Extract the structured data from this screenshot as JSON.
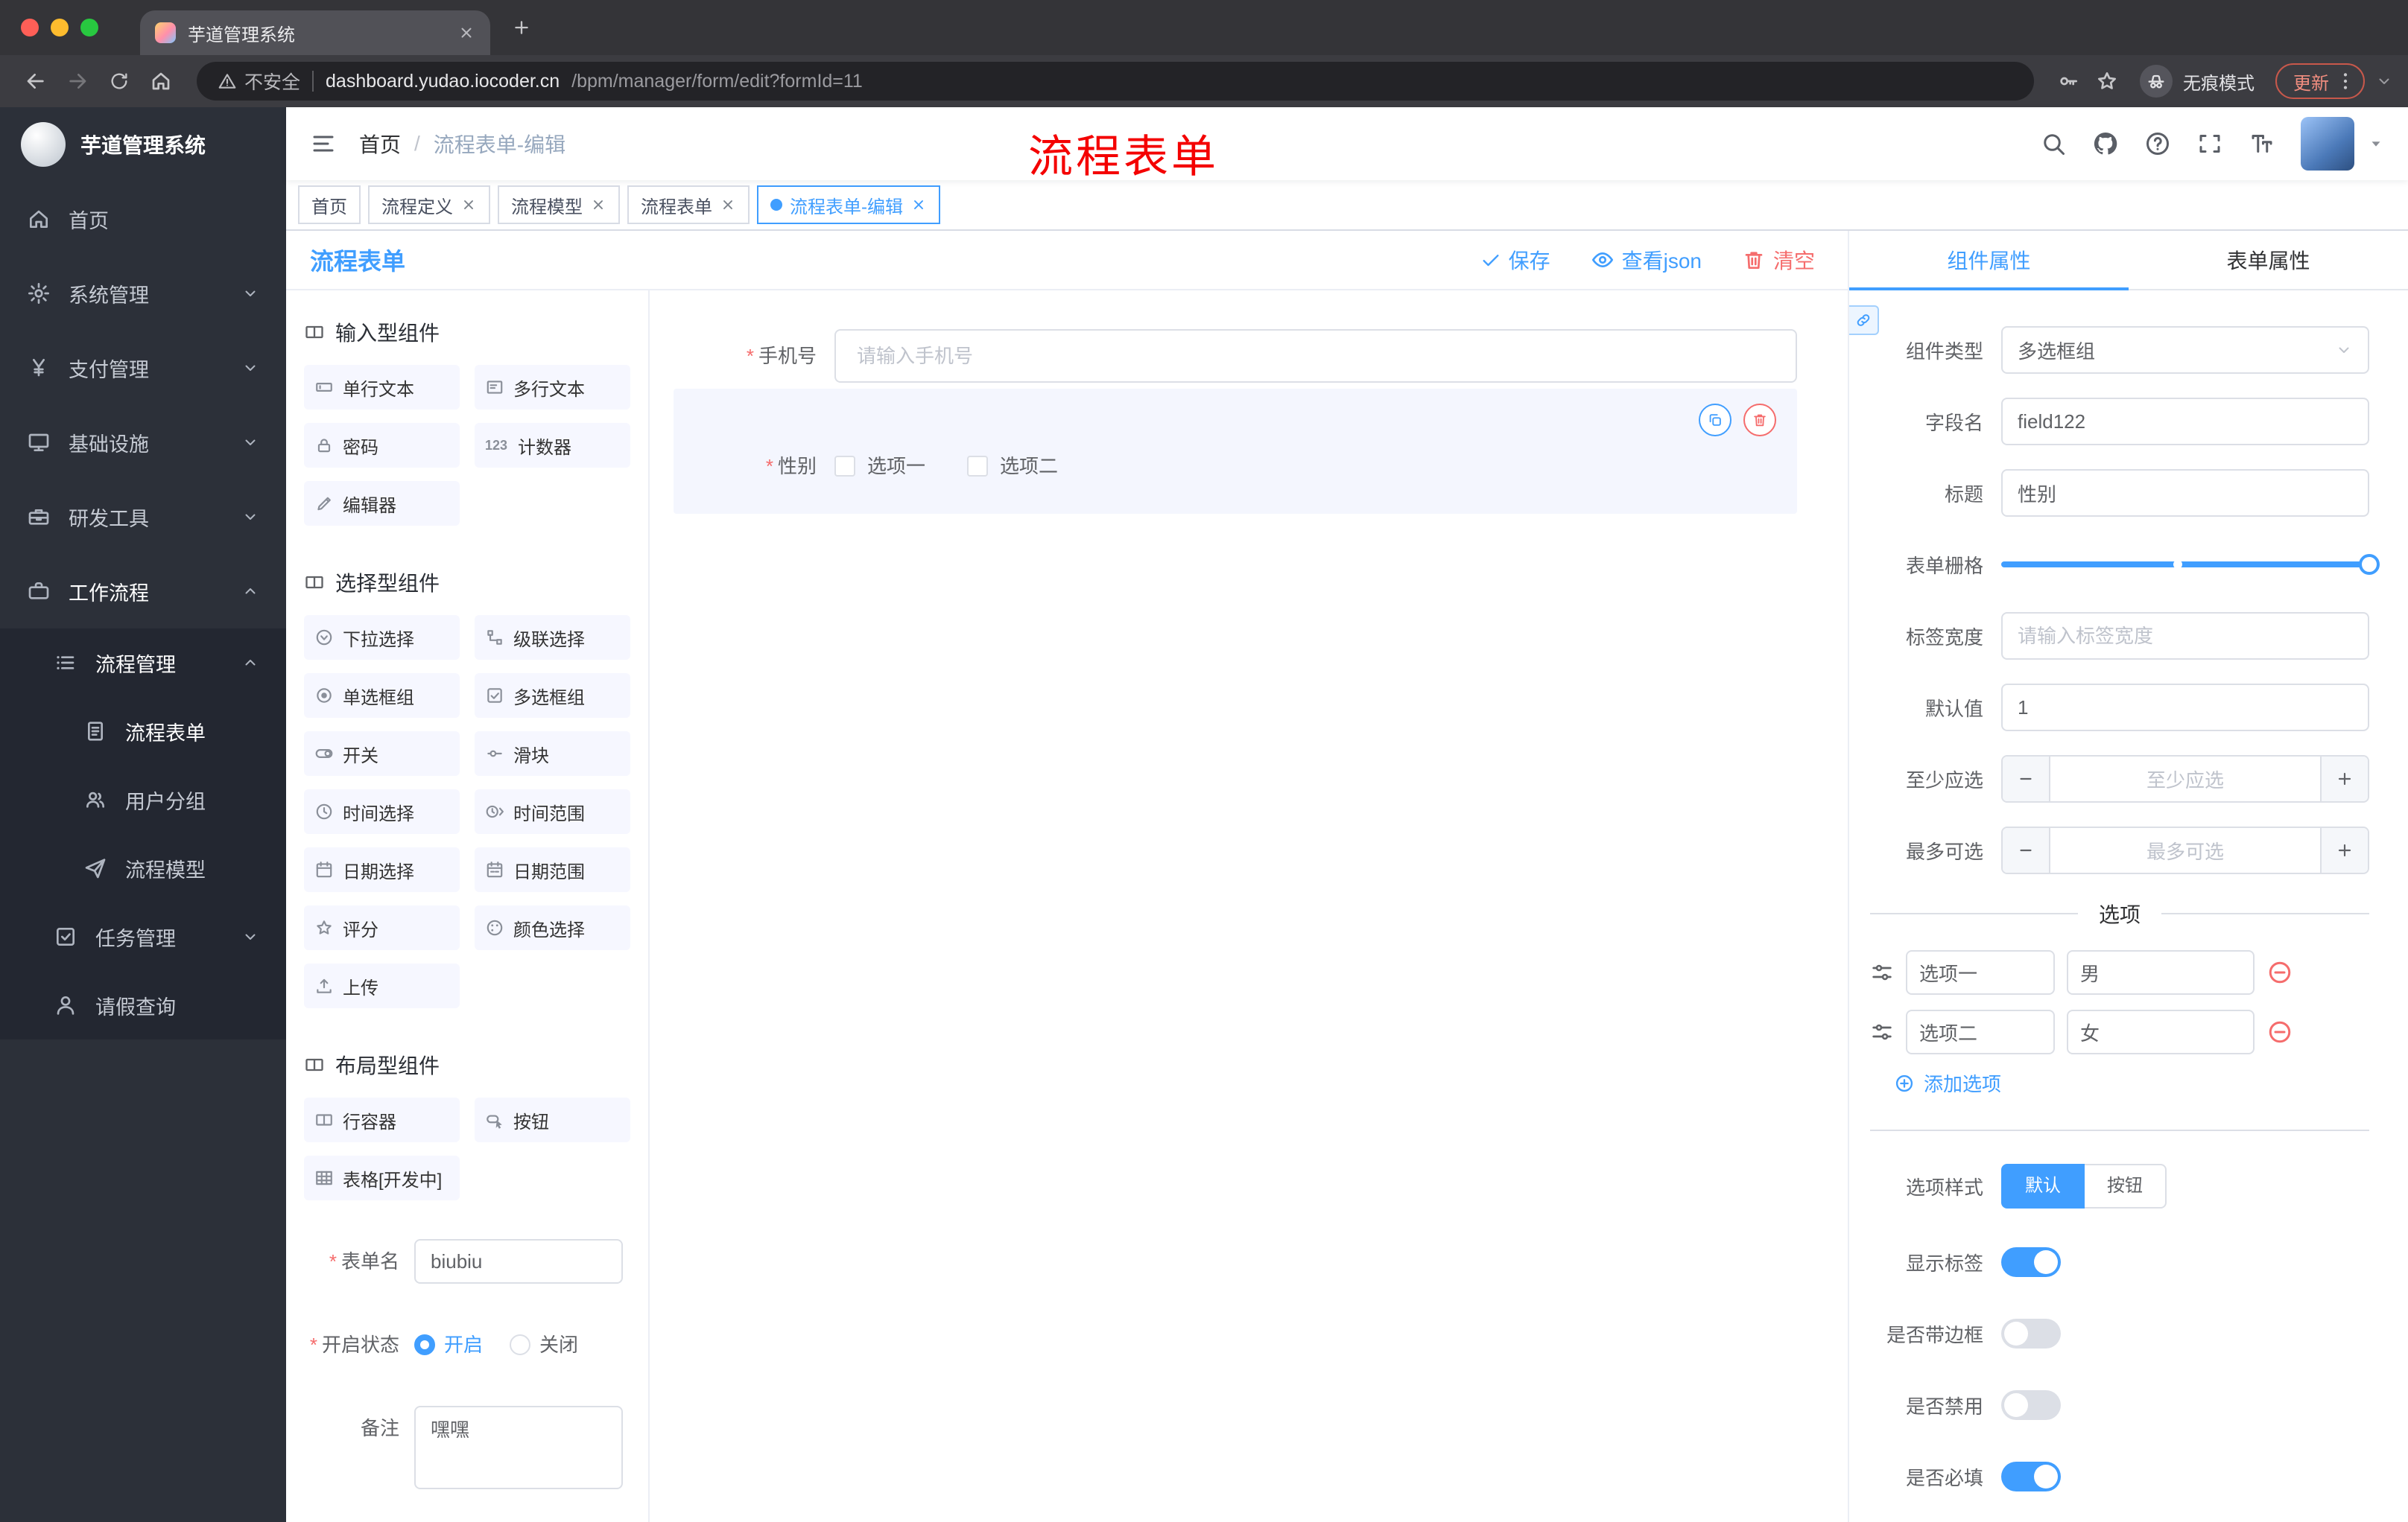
{
  "browser": {
    "tab_title": "芋道管理系统",
    "security_label": "不安全",
    "url_host": "dashboard.yudao.iocoder.cn",
    "url_path": "/bpm/manager/form/edit?formId=11",
    "incognito_label": "无痕模式",
    "update_label": "更新"
  },
  "sidebar": {
    "logo_title": "芋道管理系统",
    "items": [
      {
        "label": "首页",
        "icon": "home-icon"
      },
      {
        "label": "系统管理",
        "icon": "gear-icon"
      },
      {
        "label": "支付管理",
        "icon": "yen-icon"
      },
      {
        "label": "基础设施",
        "icon": "monitor-icon"
      },
      {
        "label": "研发工具",
        "icon": "toolbox-icon"
      },
      {
        "label": "工作流程",
        "icon": "briefcase-icon"
      },
      {
        "label": "流程管理",
        "icon": "list-icon"
      },
      {
        "label": "流程表单",
        "icon": "document-icon"
      },
      {
        "label": "用户分组",
        "icon": "users-icon"
      },
      {
        "label": "流程模型",
        "icon": "send-icon"
      },
      {
        "label": "任务管理",
        "icon": "tasks-icon"
      },
      {
        "label": "请假查询",
        "icon": "person-icon"
      }
    ]
  },
  "header": {
    "breadcrumb_home": "首页",
    "breadcrumb_sep": "/",
    "breadcrumb_current": "流程表单-编辑",
    "annotation": "流程表单"
  },
  "tags": [
    {
      "label": "首页",
      "closable": false,
      "active": false
    },
    {
      "label": "流程定义",
      "closable": true,
      "active": false
    },
    {
      "label": "流程模型",
      "closable": true,
      "active": false
    },
    {
      "label": "流程表单",
      "closable": true,
      "active": false
    },
    {
      "label": "流程表单-编辑",
      "closable": true,
      "active": true
    }
  ],
  "designer": {
    "title": "流程表单",
    "save_label": "保存",
    "view_json_label": "查看json",
    "clear_label": "清空",
    "component_groups": [
      {
        "title": "输入型组件",
        "items": [
          {
            "label": "单行文本",
            "icon": "input-icon"
          },
          {
            "label": "多行文本",
            "icon": "textarea-icon"
          },
          {
            "label": "密码",
            "icon": "lock-icon"
          },
          {
            "label": "计数器",
            "icon": "counter-icon"
          },
          {
            "label": "编辑器",
            "icon": "editor-icon"
          }
        ]
      },
      {
        "title": "选择型组件",
        "items": [
          {
            "label": "下拉选择",
            "icon": "select-icon"
          },
          {
            "label": "级联选择",
            "icon": "cascade-icon"
          },
          {
            "label": "单选框组",
            "icon": "radio-icon"
          },
          {
            "label": "多选框组",
            "icon": "checkbox-icon"
          },
          {
            "label": "开关",
            "icon": "switch-icon"
          },
          {
            "label": "滑块",
            "icon": "slider-icon"
          },
          {
            "label": "时间选择",
            "icon": "clock-icon"
          },
          {
            "label": "时间范围",
            "icon": "time-range-icon"
          },
          {
            "label": "日期选择",
            "icon": "calendar-icon"
          },
          {
            "label": "日期范围",
            "icon": "date-range-icon"
          },
          {
            "label": "评分",
            "icon": "star-icon"
          },
          {
            "label": "颜色选择",
            "icon": "color-icon"
          },
          {
            "label": "上传",
            "icon": "upload-icon"
          }
        ]
      },
      {
        "title": "布局型组件",
        "items": [
          {
            "label": "行容器",
            "icon": "row-icon"
          },
          {
            "label": "按钮",
            "icon": "button-icon"
          },
          {
            "label": "表格[开发中]",
            "icon": "table-icon"
          }
        ]
      }
    ],
    "meta": {
      "form_name_label": "表单名",
      "form_name_value": "biubiu",
      "status_label": "开启状态",
      "status_on_label": "开启",
      "status_off_label": "关闭",
      "remark_label": "备注",
      "remark_value": "嘿嘿"
    },
    "canvas": {
      "phone_label": "手机号",
      "phone_placeholder": "请输入手机号",
      "gender_label": "性别",
      "gender_option1": "选项一",
      "gender_option2": "选项二"
    }
  },
  "props": {
    "tab_component": "组件属性",
    "tab_form": "表单属性",
    "component_type_label": "组件类型",
    "component_type_value": "多选框组",
    "field_name_label": "字段名",
    "field_name_value": "field122",
    "title_label": "标题",
    "title_value": "性别",
    "grid_label": "表单栅格",
    "label_width_label": "标签宽度",
    "label_width_placeholder": "请输入标签宽度",
    "default_label": "默认值",
    "default_value": "1",
    "min_label": "至少应选",
    "min_placeholder": "至少应选",
    "max_label": "最多可选",
    "max_placeholder": "最多可选",
    "options_title": "选项",
    "options": [
      {
        "label": "选项一",
        "value": "男"
      },
      {
        "label": "选项二",
        "value": "女"
      }
    ],
    "add_option_label": "添加选项",
    "style_label": "选项样式",
    "style_default": "默认",
    "style_button": "按钮",
    "show_label_label": "显示标签",
    "show_label_on": true,
    "border_label": "是否带边框",
    "border_on": false,
    "disabled_label": "是否禁用",
    "disabled_on": false,
    "required_label": "是否必填",
    "required_on": true
  }
}
